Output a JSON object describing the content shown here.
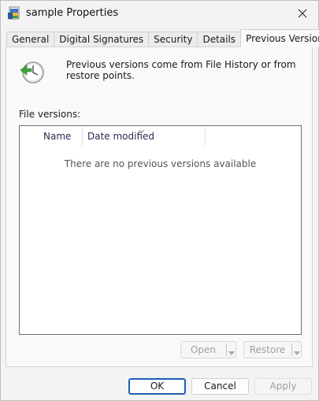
{
  "window": {
    "title": "sample Properties"
  },
  "tabs": [
    {
      "label": "General",
      "active": false
    },
    {
      "label": "Digital Signatures",
      "active": false
    },
    {
      "label": "Security",
      "active": false
    },
    {
      "label": "Details",
      "active": false
    },
    {
      "label": "Previous Versions",
      "active": true
    }
  ],
  "panel": {
    "info_text": "Previous versions come from File History or from restore points.",
    "versions_label": "File versions:",
    "columns": [
      "Name",
      "Date modified"
    ],
    "empty_text": "There are no previous versions available"
  },
  "actions": {
    "open_label": "Open",
    "restore_label": "Restore"
  },
  "footer": {
    "ok_label": "OK",
    "cancel_label": "Cancel",
    "apply_label": "Apply"
  },
  "colors": {
    "accent": "#1a5fb4",
    "window_bg": "#f3f3f3",
    "panel_bg": "#f9f9f9",
    "disabled_text": "#a0a0a0"
  }
}
